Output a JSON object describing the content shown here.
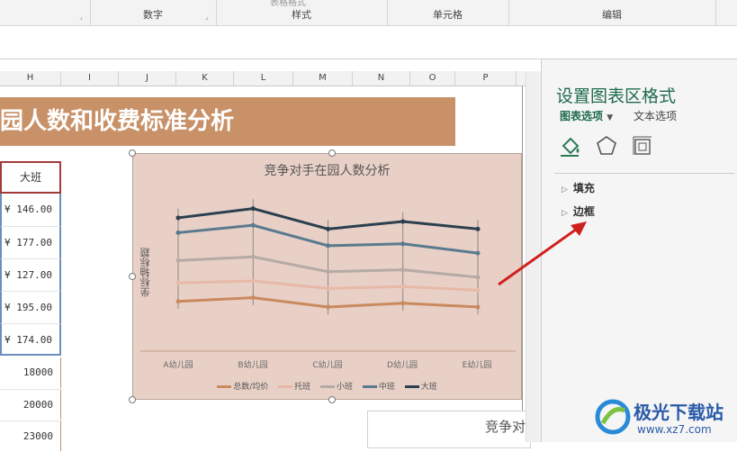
{
  "ribbon": {
    "groups": [
      "数字",
      "样式",
      "单元格",
      "编辑"
    ],
    "cut_top_text": "表格格式"
  },
  "columns": [
    "H",
    "I",
    "J",
    "K",
    "L",
    "M",
    "N",
    "O",
    "P"
  ],
  "sheet": {
    "banner_title": "园人数和收费标准分析",
    "header_cell": "大班",
    "fee_values": [
      "¥  146.00",
      "¥  177.00",
      "¥  127.00",
      "¥  195.00",
      "¥  174.00"
    ],
    "count_values": [
      "18000",
      "20000",
      "23000"
    ]
  },
  "chart_data": {
    "type": "line",
    "title": "竞争对手在园人数分析",
    "ylabel": "坐标轴标题",
    "xlabel": "",
    "categories": [
      "A幼儿园",
      "B幼儿园",
      "C幼儿园",
      "D幼儿园",
      "E幼儿园"
    ],
    "series": [
      {
        "name": "总数/均价",
        "color": "#c98a5e",
        "values": [
          20,
          22,
          17,
          19,
          17
        ]
      },
      {
        "name": "托班",
        "color": "#e8b8a8",
        "values": [
          30,
          31,
          27,
          28,
          26
        ]
      },
      {
        "name": "小班",
        "color": "#b5aaa5",
        "values": [
          42,
          44,
          36,
          37,
          33
        ]
      },
      {
        "name": "中班",
        "color": "#5a7a8e",
        "values": [
          57,
          61,
          50,
          51,
          46
        ]
      },
      {
        "name": "大班",
        "color": "#2b3f4e",
        "values": [
          65,
          70,
          59,
          63,
          59
        ]
      }
    ],
    "ylim": [
      0,
      80
    ],
    "grid": false,
    "legend_position": "bottom"
  },
  "second_chart": {
    "title_partial": "竞争对"
  },
  "panel": {
    "title": "设置图表区格式",
    "tabs": [
      "图表选项",
      "文本选项"
    ],
    "icons": [
      "fill-bucket-icon",
      "pentagon-icon",
      "size-properties-icon"
    ],
    "sections": [
      "填充",
      "边框"
    ]
  },
  "watermark": {
    "name": "极光下载站",
    "url": "www.xz7.com"
  },
  "colors": {
    "accent": "#1f6b4d",
    "banner": "#c89168",
    "chart_bg": "#e8d0c7",
    "arrow": "#d0201e"
  }
}
